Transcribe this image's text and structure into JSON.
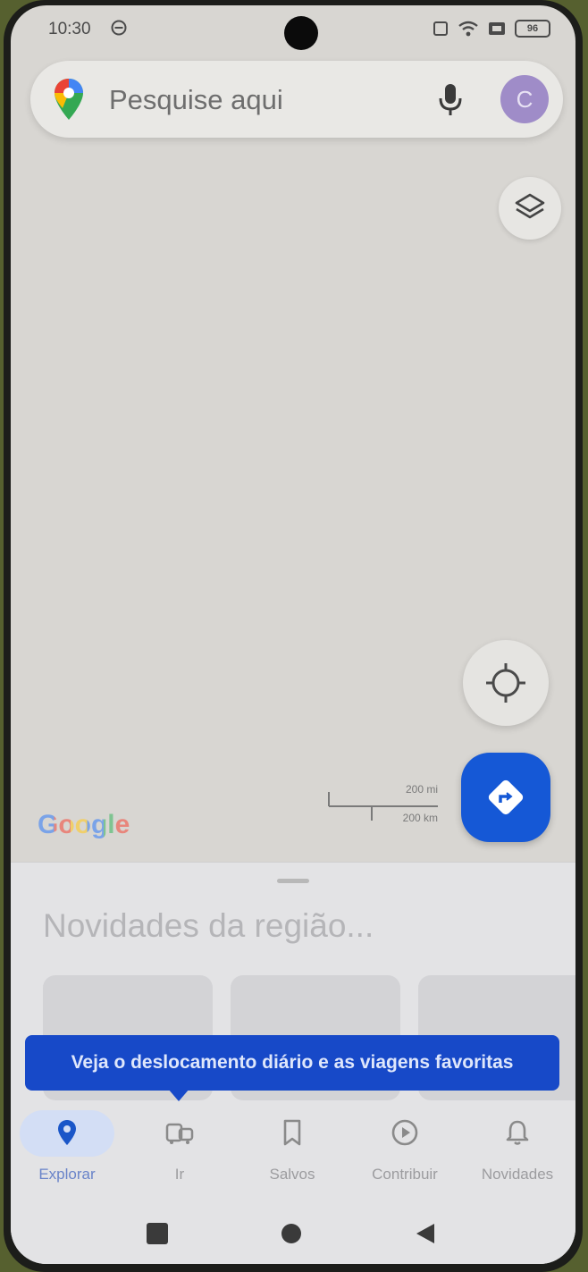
{
  "status_bar": {
    "time": "10:30",
    "battery": "96"
  },
  "search": {
    "placeholder": "Pesquise aqui",
    "avatar_initial": "C"
  },
  "map": {
    "attribution": "Google",
    "scale_top": "200 mi",
    "scale_bottom": "200 km"
  },
  "sheet": {
    "title": "Novidades da região..."
  },
  "tooltip": {
    "text": "Veja o deslocamento diário e as viagens favoritas"
  },
  "bottom_nav": {
    "items": [
      {
        "label": "Explorar",
        "icon": "location-pin-icon",
        "active": true
      },
      {
        "label": "Ir",
        "icon": "commute-icon",
        "active": false
      },
      {
        "label": "Salvos",
        "icon": "bookmark-icon",
        "active": false
      },
      {
        "label": "Contribuir",
        "icon": "add-circle-icon",
        "active": false
      },
      {
        "label": "Novidades",
        "icon": "bell-icon",
        "active": false
      }
    ]
  },
  "colors": {
    "accent": "#1558d6",
    "map_background": "#d8d6d2",
    "tooltip": "#1749c8",
    "avatar": "#9f8cc8"
  }
}
